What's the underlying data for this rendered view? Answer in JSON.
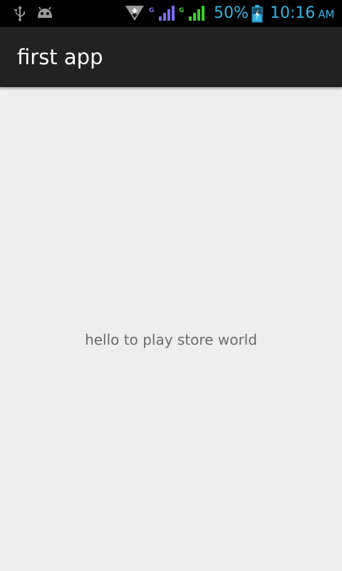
{
  "status_bar": {
    "left_icons": [
      "usb-icon",
      "android-debug-icon"
    ],
    "right_icons": [
      "data-transfer-icon",
      "signal-strength-icon-1",
      "signal-strength-icon-2",
      "battery-charging-icon"
    ],
    "network_type_1": "G",
    "network_type_2": "G",
    "battery_level": "50%",
    "time": "10:16",
    "ampm": "AM",
    "colors": {
      "text": "#33b5e5",
      "signal_1": "#7c6cf0",
      "signal_2": "#3ccf2c"
    }
  },
  "action_bar": {
    "title": "first app",
    "background": "#222222"
  },
  "main": {
    "message": "hello to play store world",
    "background": "#eeeeee"
  }
}
